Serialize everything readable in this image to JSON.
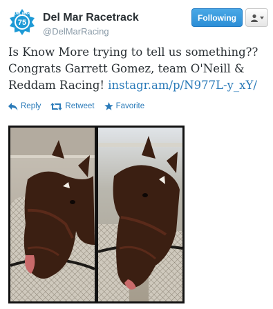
{
  "account": {
    "name": "Del Mar Racetrack",
    "handle": "@DelMarRacing",
    "avatar_text_top": "DEL MAR",
    "avatar_number": "75"
  },
  "buttons": {
    "follow_label": "Following"
  },
  "tweet": {
    "text_line1": "Is Know More trying to tell us something??",
    "text_line2": "Congrats Garrett Gomez, team O'Neill &",
    "text_line3": "Reddam Racing! ",
    "link_text": "instagr.am/p/N977L-y_xY/"
  },
  "actions": {
    "reply": "Reply",
    "retweet": "Retweet",
    "favorite": "Favorite"
  },
  "colors": {
    "brand_blue": "#2b7bb9",
    "follow_button": "#2c8ed6"
  },
  "icons": [
    "del-mar-logo",
    "user-icon",
    "reply-icon",
    "retweet-icon",
    "star-icon"
  ]
}
